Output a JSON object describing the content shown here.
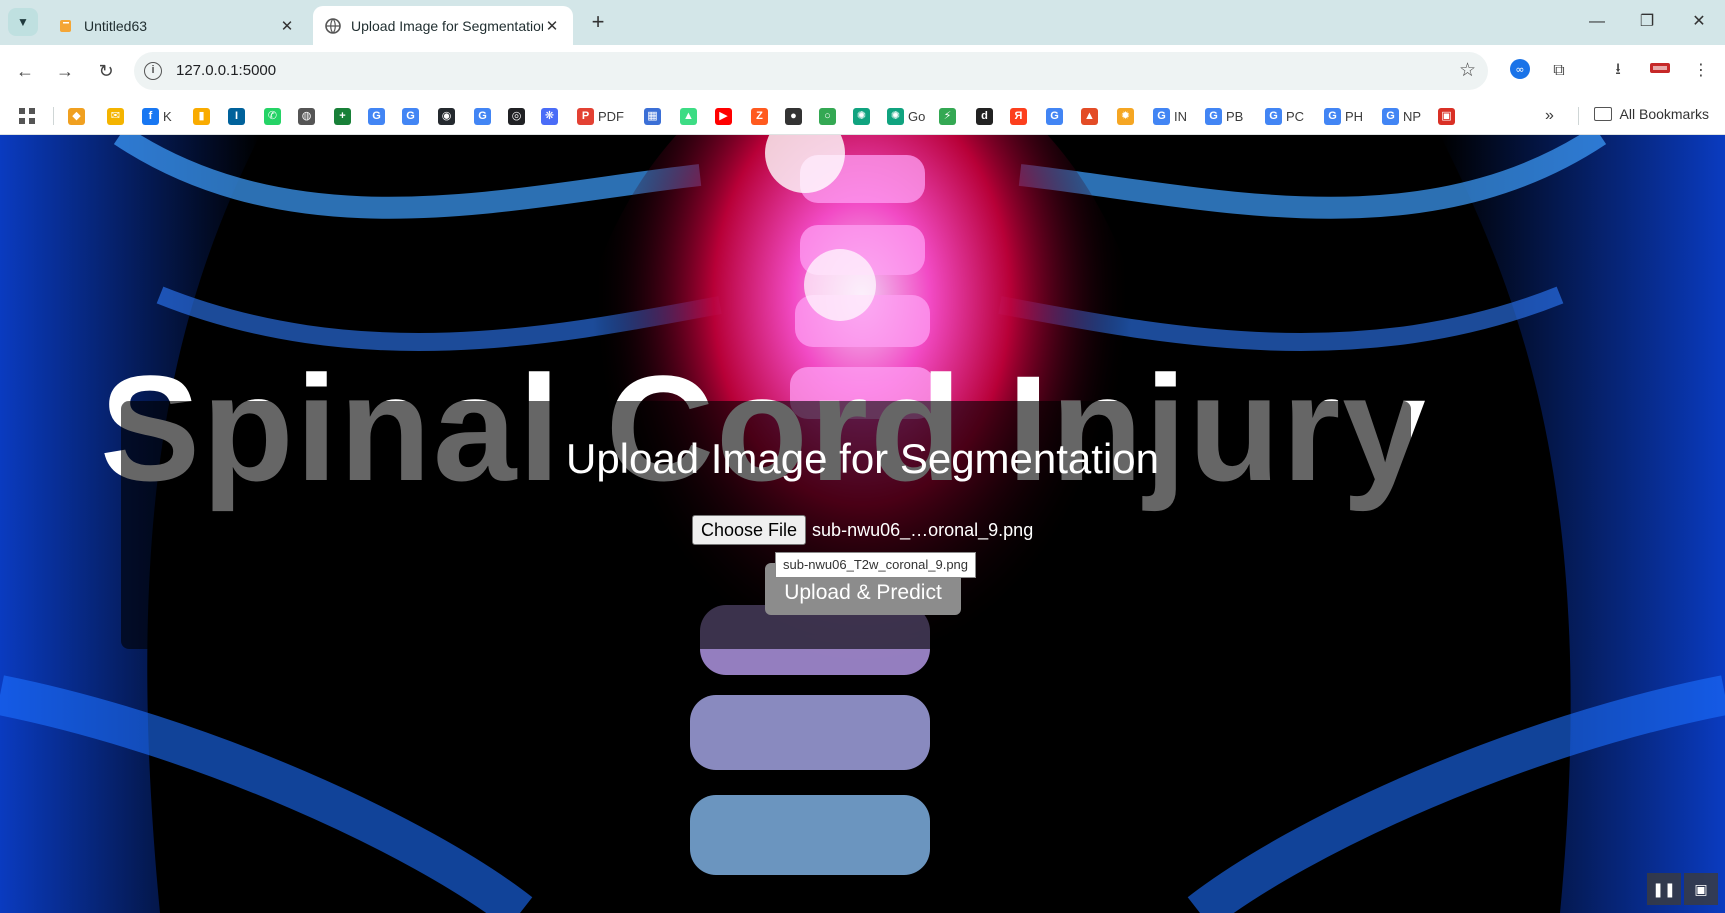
{
  "tabs": [
    {
      "title": "Untitled63",
      "active": false
    },
    {
      "title": "Upload Image for Segmentation",
      "active": true
    }
  ],
  "toolbar": {
    "url": "127.0.0.1:5000"
  },
  "bookmarks": [
    {
      "label": "",
      "color": "#f0a020",
      "glyph": "◆"
    },
    {
      "label": "",
      "color": "#f4b400",
      "glyph": "✉"
    },
    {
      "label": "K",
      "color": "#1877f2",
      "glyph": "f"
    },
    {
      "label": "",
      "color": "#f9ab00",
      "glyph": "▮"
    },
    {
      "label": "",
      "color": "#00629b",
      "glyph": "I"
    },
    {
      "label": "",
      "color": "#25d366",
      "glyph": "✆"
    },
    {
      "label": "",
      "color": "#555555",
      "glyph": "◍"
    },
    {
      "label": "",
      "color": "#188038",
      "glyph": "+"
    },
    {
      "label": "",
      "color": "#4285f4",
      "glyph": "G"
    },
    {
      "label": "",
      "color": "#4285f4",
      "glyph": "G"
    },
    {
      "label": "",
      "color": "#24292e",
      "glyph": "◉"
    },
    {
      "label": "",
      "color": "#4285f4",
      "glyph": "G"
    },
    {
      "label": "",
      "color": "#202124",
      "glyph": "◎"
    },
    {
      "label": "",
      "color": "#4a6cf7",
      "glyph": "❋"
    },
    {
      "label": "PDF",
      "color": "#e34133",
      "glyph": "P"
    },
    {
      "label": "",
      "color": "#3b6fd6",
      "glyph": "▦"
    },
    {
      "label": "",
      "color": "#3ddc84",
      "glyph": "▲"
    },
    {
      "label": "",
      "color": "#ff0000",
      "glyph": "▶"
    },
    {
      "label": "",
      "color": "#ff5a1f",
      "glyph": "Z"
    },
    {
      "label": "",
      "color": "#333333",
      "glyph": "●"
    },
    {
      "label": "",
      "color": "#34a853",
      "glyph": "○"
    },
    {
      "label": "",
      "color": "#10a37f",
      "glyph": "✺"
    },
    {
      "label": "Go",
      "color": "#10a37f",
      "glyph": "✺"
    },
    {
      "label": "",
      "color": "#34a853",
      "glyph": "⚡"
    },
    {
      "label": "",
      "color": "#222222",
      "glyph": "d"
    },
    {
      "label": "",
      "color": "#fc3f1d",
      "glyph": "Я"
    },
    {
      "label": "",
      "color": "#4285f4",
      "glyph": "G"
    },
    {
      "label": "",
      "color": "#e34c26",
      "glyph": "▲"
    },
    {
      "label": "",
      "color": "#f5a623",
      "glyph": "✹"
    },
    {
      "label": "IN",
      "color": "#4285f4",
      "glyph": "G"
    },
    {
      "label": "PB",
      "color": "#4285f4",
      "glyph": "G"
    },
    {
      "label": "PC",
      "color": "#4285f4",
      "glyph": "G"
    },
    {
      "label": "PH",
      "color": "#4285f4",
      "glyph": "G"
    },
    {
      "label": "NP",
      "color": "#4285f4",
      "glyph": "G"
    },
    {
      "label": "",
      "color": "#d93025",
      "glyph": "▣"
    }
  ],
  "bookmarks_overflow": "»",
  "all_bookmarks": "All Bookmarks",
  "page": {
    "background_text": "Spinal Cord Injury",
    "heading": "Upload Image for Segmentation",
    "choose_file_label": "Choose File",
    "file_name_display": "sub-nwu06_…oronal_9.png",
    "tooltip": "sub-nwu06_T2w_coronal_9.png",
    "upload_button": "Upload & Predict"
  }
}
